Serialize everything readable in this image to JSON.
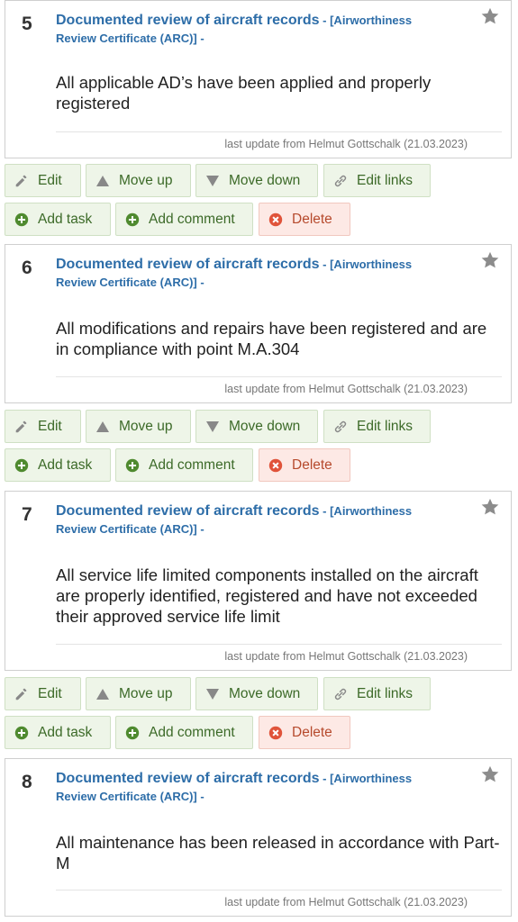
{
  "items": [
    {
      "number": "5",
      "title": "Documented review of aircraft records",
      "tag": " - [Airworthiness Review Certificate (ARC)] -",
      "text": "All applicable AD’s have been applied and properly registered",
      "footer": "last update from Helmut Gottschalk (21.03.2023)"
    },
    {
      "number": "6",
      "title": "Documented review of aircraft records",
      "tag": " - [Airworthiness Review Certificate (ARC)] -",
      "text": "All modifications and repairs have been registered and are in compliance with point M.A.304",
      "footer": "last update from Helmut Gottschalk (21.03.2023)"
    },
    {
      "number": "7",
      "title": "Documented review of aircraft records",
      "tag": " - [Airworthiness Review Certificate (ARC)] -",
      "text": "All service life limited components installed on the aircraft are properly identified, registered and have not exceeded their approved service life limit",
      "footer": "last update from Helmut Gottschalk (21.03.2023)"
    },
    {
      "number": "8",
      "title": "Documented review of aircraft records",
      "tag": " - [Airworthiness Review Certificate (ARC)] -",
      "text": "All maintenance has been released in accordance with Part-M",
      "footer": "last update from Helmut Gottschalk (21.03.2023)"
    }
  ],
  "actions": {
    "edit": "Edit",
    "move_up": "Move up",
    "move_down": "Move down",
    "edit_links": "Edit links",
    "add_task": "Add task",
    "add_comment": "Add comment",
    "delete": "Delete"
  },
  "colors": {
    "title": "#2d6da8",
    "button_bg": "#eef5e8",
    "delete_bg": "#fde9e5",
    "delete_icon": "#e0533a",
    "add_icon": "#4f8a2f"
  }
}
